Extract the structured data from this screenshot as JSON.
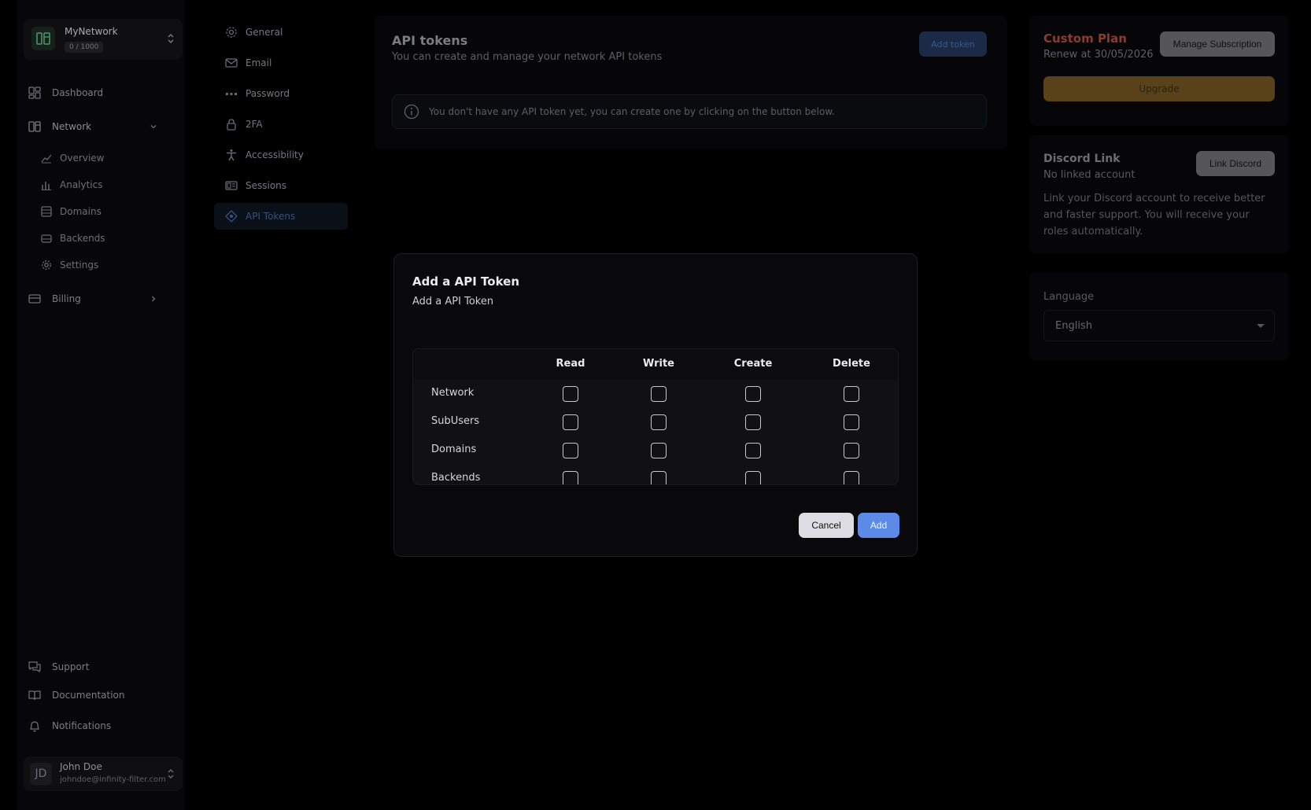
{
  "sidebar": {
    "network": {
      "name": "MyNetwork",
      "count": "0 / 1000"
    },
    "items": {
      "dashboard": "Dashboard",
      "network": "Network",
      "overview": "Overview",
      "analytics": "Analytics",
      "domains": "Domains",
      "backends": "Backends",
      "settings": "Settings",
      "billing": "Billing",
      "support": "Support",
      "documentation": "Documentation",
      "notifications": "Notifications"
    },
    "user": {
      "initials": "JD",
      "name": "John Doe",
      "email": "johndoe@infinity-filter.com"
    }
  },
  "settings_nav": {
    "general": "General",
    "email": "Email",
    "password": "Password",
    "twofa": "2FA",
    "accessibility": "Accessibility",
    "sessions": "Sessions",
    "api_tokens": "API Tokens"
  },
  "main": {
    "title": "API tokens",
    "subtitle": "You can create and manage your network API tokens",
    "add_token_label": "Add token",
    "notice": "You don't have any API token yet, you can create one by clicking on the button below."
  },
  "plan": {
    "name": "Custom Plan",
    "renew": "Renew at 30/05/2026",
    "manage_label": "Manage Subscription",
    "upgrade_label": "Upgrade"
  },
  "discord": {
    "title": "Discord Link",
    "status": "No linked account",
    "description": "Link your Discord account to receive better and faster support. You will receive your roles automatically.",
    "link_label": "Link Discord"
  },
  "language": {
    "label": "Language",
    "value": "English"
  },
  "modal": {
    "title": "Add a API Token",
    "subtitle": "Add a API Token",
    "columns": {
      "read": "Read",
      "write": "Write",
      "create": "Create",
      "delete": "Delete"
    },
    "rows": {
      "network": "Network",
      "subusers": "SubUsers",
      "domains": "Domains",
      "backends": "Backends"
    },
    "cancel_label": "Cancel",
    "add_label": "Add"
  },
  "colors": {
    "accent": "#5b8be6",
    "plan": "#8d3b2f",
    "upgrade": "#59421a",
    "active_nav": "#35527e"
  }
}
